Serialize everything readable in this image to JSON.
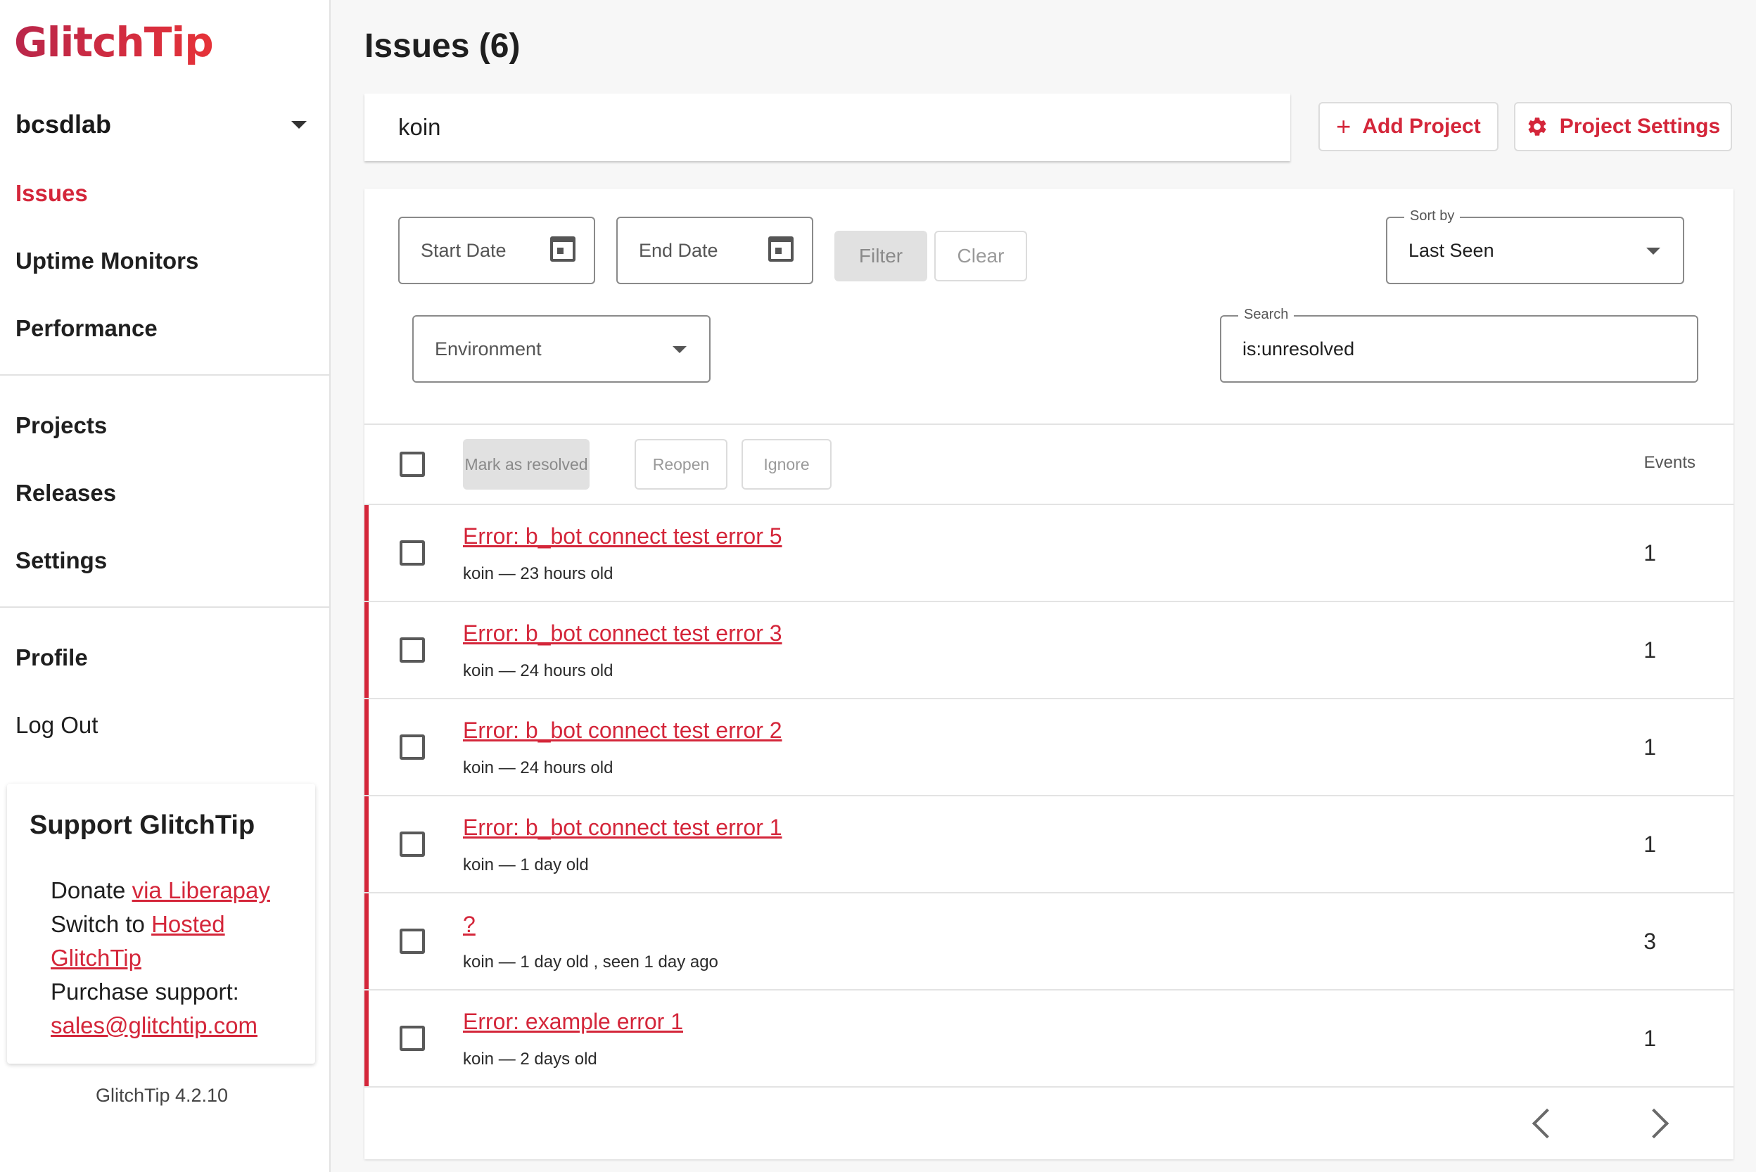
{
  "sidebar": {
    "logo": "GlitchTip",
    "org": "bcsdlab",
    "nav_primary": [
      "Issues",
      "Uptime Monitors",
      "Performance"
    ],
    "nav_secondary": [
      "Projects",
      "Releases",
      "Settings"
    ],
    "profile": "Profile",
    "logout": "Log Out",
    "support": {
      "title": "Support GlitchTip",
      "donate_prefix": "Donate ",
      "donate_link": "via Liberapay",
      "switch_prefix": "Switch to ",
      "switch_link": "Hosted GlitchTip",
      "purchase": "Purchase support:",
      "email": "sales@glitchtip.com"
    },
    "version": "GlitchTip 4.2.10"
  },
  "header": {
    "title": "Issues (6)",
    "project": "koin",
    "add_project": "Add Project",
    "project_settings": "Project Settings"
  },
  "filters": {
    "start_date": "Start Date",
    "end_date": "End Date",
    "filter": "Filter",
    "clear": "Clear",
    "sort_label": "Sort by",
    "sort_value": "Last Seen",
    "environment": "Environment",
    "search_label": "Search",
    "search_value": "is:unresolved"
  },
  "actions": {
    "mark_resolved": "Mark as resolved",
    "reopen": "Reopen",
    "ignore": "Ignore",
    "events_header": "Events"
  },
  "issues": [
    {
      "title": "Error: b_bot connect test error 5",
      "meta": "koin — 23 hours old",
      "events": "1"
    },
    {
      "title": "Error: b_bot connect test error 3",
      "meta": "koin — 24 hours old",
      "events": "1"
    },
    {
      "title": "Error: b_bot connect test error 2",
      "meta": "koin — 24 hours old",
      "events": "1"
    },
    {
      "title": "Error: b_bot connect test error 1",
      "meta": "koin — 1 day old",
      "events": "1"
    },
    {
      "title": "?",
      "meta": "koin — 1 day old , seen 1 day ago",
      "events": "3"
    },
    {
      "title": "Error: example error 1",
      "meta": "koin — 2 days old",
      "events": "1"
    }
  ],
  "colors": {
    "accent": "#d4263a",
    "text": "#1f1f1f",
    "border": "#e3e3e3"
  }
}
